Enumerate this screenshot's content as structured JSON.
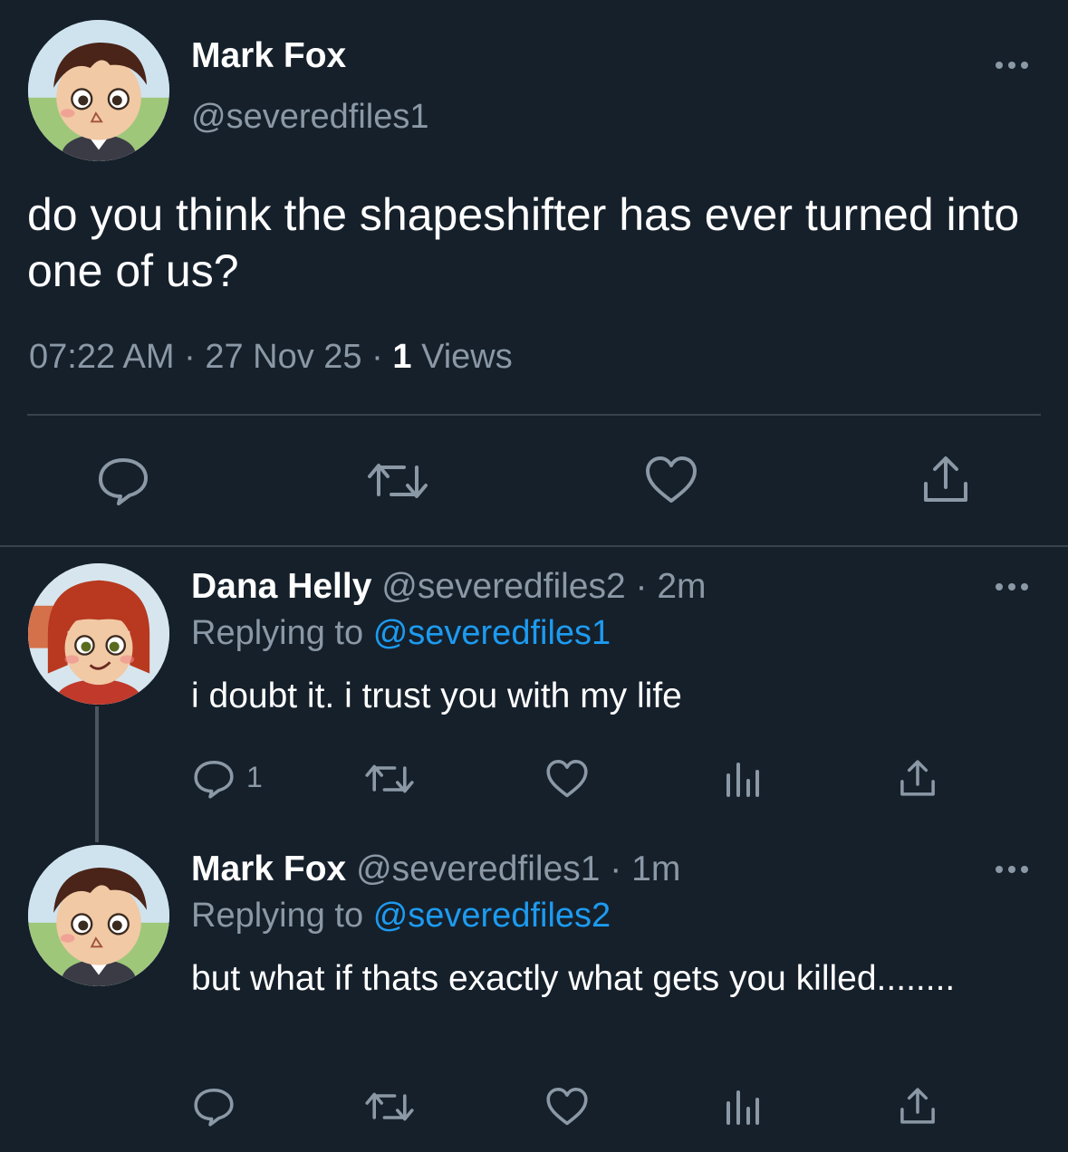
{
  "main_tweet": {
    "author_name": "Mark Fox",
    "handle": "@severedfiles1",
    "text": "do you think the shapeshifter has ever turned into one of us?",
    "time": "07:22 AM",
    "date": "27 Nov 25",
    "views_count": "1",
    "views_label": "Views",
    "separator": "·"
  },
  "replies": [
    {
      "author_name": "Dana Helly",
      "handle": "@severedfiles2",
      "age": "2m",
      "replying_prefix": "Replying to",
      "replying_to": "@severedfiles1",
      "text": "i doubt it. i trust you with my life",
      "reply_count": "1"
    },
    {
      "author_name": "Mark Fox",
      "handle": "@severedfiles1",
      "age": "1m",
      "replying_prefix": "Replying to",
      "replying_to": "@severedfiles2",
      "text": "but what if thats exactly what gets you killed........"
    }
  ],
  "colors": {
    "background": "#15202b",
    "muted": "#8b98a5",
    "link": "#1d9bf0",
    "divider": "#38444d"
  }
}
